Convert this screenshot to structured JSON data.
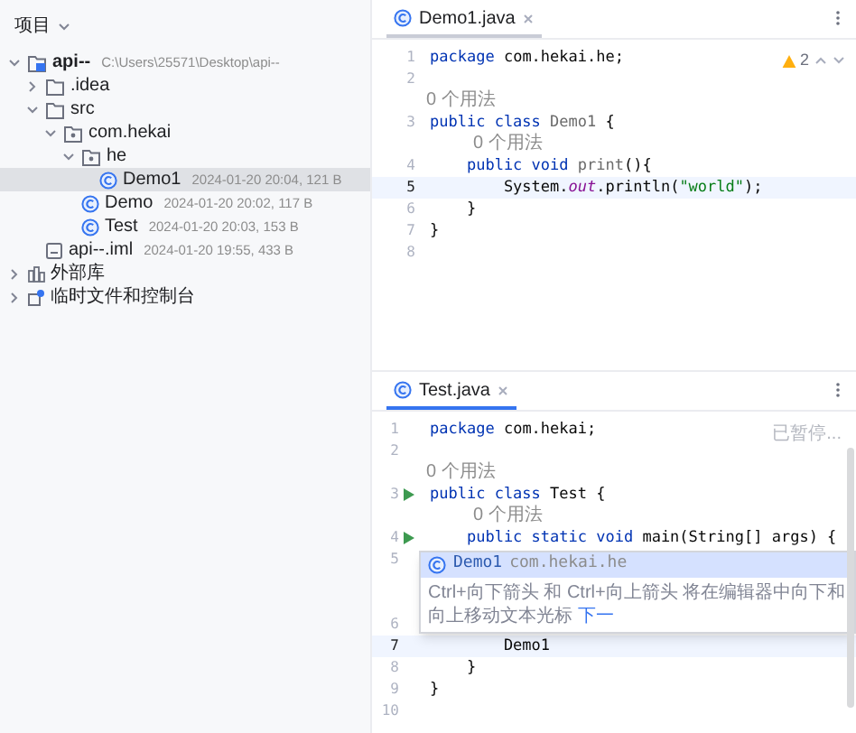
{
  "project_panel": {
    "title": "项目"
  },
  "tree": [
    {
      "label": "api--",
      "detail": "C:\\Users\\25571\\Desktop\\api--",
      "kind": "module",
      "expanded": true,
      "selected": false,
      "children": [
        {
          "label": ".idea",
          "kind": "folder",
          "expanded": false,
          "selected": false
        },
        {
          "label": "src",
          "kind": "folder",
          "expanded": true,
          "selected": false,
          "children": [
            {
              "label": "com.hekai",
              "kind": "package",
              "expanded": true,
              "selected": false,
              "children": [
                {
                  "label": "he",
                  "kind": "package",
                  "expanded": true,
                  "selected": false,
                  "children": [
                    {
                      "label": "Demo1",
                      "detail": "2024-01-20 20:04, 121 B",
                      "kind": "class",
                      "selected": true
                    }
                  ]
                },
                {
                  "label": "Demo",
                  "detail": "2024-01-20 20:02, 117 B",
                  "kind": "class",
                  "selected": false
                },
                {
                  "label": "Test",
                  "detail": "2024-01-20 20:03, 153 B",
                  "kind": "class",
                  "selected": false
                }
              ]
            }
          ]
        },
        {
          "label": "api--.iml",
          "detail": "2024-01-20 19:55, 433 B",
          "kind": "file",
          "selected": false
        }
      ]
    },
    {
      "label": "外部库",
      "kind": "library",
      "expanded": false,
      "selected": false
    },
    {
      "label": "临时文件和控制台",
      "kind": "scratch",
      "expanded": false,
      "selected": false
    }
  ],
  "editors": [
    {
      "tab": {
        "label": "Demo1.java",
        "selected": false
      },
      "warnings": "2",
      "lines": [
        {
          "kind": "code",
          "number": "1",
          "current": false,
          "segments": [
            {
              "text": "package ",
              "kind": "kw"
            },
            {
              "text": "com.hekai.he;",
              "kind": "plain"
            }
          ]
        },
        {
          "kind": "code",
          "number": "2",
          "current": false
        },
        {
          "kind": "hint",
          "text": "0 个用法"
        },
        {
          "kind": "code",
          "number": "3",
          "current": false,
          "segments": [
            {
              "text": "public class ",
              "kind": "kw"
            },
            {
              "text": "Demo1 ",
              "kind": "unused"
            },
            {
              "text": "{",
              "kind": "plain"
            }
          ]
        },
        {
          "kind": "hint",
          "text": "0 个用法"
        },
        {
          "kind": "code",
          "number": "4",
          "current": false,
          "segments": [
            {
              "text": "    public void ",
              "kind": "kw"
            },
            {
              "text": "print",
              "kind": "unused"
            },
            {
              "text": "(){",
              "kind": "plain"
            }
          ]
        },
        {
          "kind": "code",
          "number": "5",
          "current": true,
          "segments": [
            {
              "text": "        System.",
              "kind": "plain"
            },
            {
              "text": "out",
              "kind": "field"
            },
            {
              "text": ".println(",
              "kind": "plain"
            },
            {
              "text": "\"world\"",
              "kind": "str"
            },
            {
              "text": ");",
              "kind": "plain"
            }
          ]
        },
        {
          "kind": "code",
          "number": "6",
          "current": false,
          "segments": [
            {
              "text": "    }",
              "kind": "plain"
            }
          ]
        },
        {
          "kind": "code",
          "number": "7",
          "current": false,
          "segments": [
            {
              "text": "}",
              "kind": "plain"
            }
          ]
        },
        {
          "kind": "code",
          "number": "8",
          "current": false
        }
      ]
    },
    {
      "tab": {
        "label": "Test.java",
        "selected": true
      },
      "status": "已暂停...",
      "lines": [
        {
          "kind": "code",
          "number": "1",
          "current": false,
          "run": false,
          "segments": [
            {
              "text": "package ",
              "kind": "kw"
            },
            {
              "text": "com.hekai;",
              "kind": "plain"
            }
          ]
        },
        {
          "kind": "code",
          "number": "2",
          "current": false,
          "run": false
        },
        {
          "kind": "hint",
          "text": "0 个用法"
        },
        {
          "kind": "code",
          "number": "3",
          "current": false,
          "run": true,
          "segments": [
            {
              "text": "public class ",
              "kind": "kw"
            },
            {
              "text": "Test ",
              "kind": "plain"
            },
            {
              "text": "{",
              "kind": "plain"
            }
          ]
        },
        {
          "kind": "hint",
          "text": "0 个用法"
        },
        {
          "kind": "code",
          "number": "4",
          "current": false,
          "run": true,
          "segments": [
            {
              "text": "    public static void ",
              "kind": "kw"
            },
            {
              "text": "main(String[] args) {",
              "kind": "plain"
            }
          ]
        },
        {
          "kind": "code",
          "number": "5",
          "current": false,
          "run": false
        },
        {
          "kind": "code",
          "number": "6",
          "current": false,
          "run": false
        },
        {
          "kind": "code",
          "number": "7",
          "current": true,
          "run": false,
          "segments": [
            {
              "text": "        Demo1",
              "kind": "plain"
            }
          ]
        },
        {
          "kind": "code",
          "number": "8",
          "current": false,
          "run": false,
          "segments": [
            {
              "text": "    }",
              "kind": "plain"
            }
          ]
        },
        {
          "kind": "code",
          "number": "9",
          "current": false,
          "run": false,
          "segments": [
            {
              "text": "}",
              "kind": "plain"
            }
          ]
        },
        {
          "kind": "code",
          "number": "10",
          "current": false,
          "run": false
        }
      ],
      "popup": {
        "suggestion": "Demo1",
        "package": "com.hekai.he",
        "hint": "Ctrl+向下箭头 和 Ctrl+向上箭头 将在编辑器中向下和向上移动文本光标",
        "link": "下一"
      }
    }
  ]
}
